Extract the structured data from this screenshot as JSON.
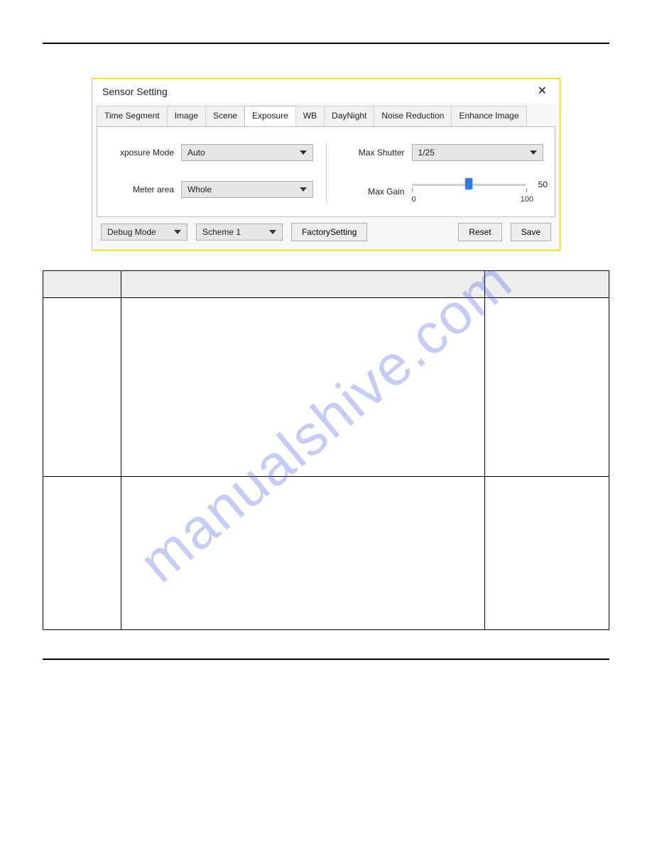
{
  "dialog": {
    "title": "Sensor Setting",
    "tabs": [
      "Time Segment",
      "Image",
      "Scene",
      "Exposure",
      "WB",
      "DayNight",
      "Noise Reduction",
      "Enhance Image"
    ],
    "active_tab_index": 3,
    "left": {
      "exposure_mode_label": "xposure Mode",
      "exposure_mode_value": "Auto",
      "meter_area_label": "Meter area",
      "meter_area_value": "Whole"
    },
    "right": {
      "max_shutter_label": "Max Shutter",
      "max_shutter_value": "1/25",
      "max_gain_label": "Max Gain",
      "max_gain_value": "50",
      "max_gain_min": "0",
      "max_gain_max": "100"
    },
    "footer": {
      "debug_mode_label": "Debug Mode",
      "scheme_label": "Scheme 1",
      "factory_btn": "FactorySetting",
      "reset_btn": "Reset",
      "save_btn": "Save"
    }
  },
  "watermark": "manualshive.com",
  "table": {
    "headers": [
      "",
      "",
      ""
    ],
    "rows": [
      {
        "c1": "",
        "c2": "",
        "c3": ""
      },
      {
        "c1": "",
        "c2": "",
        "c3": ""
      }
    ]
  }
}
